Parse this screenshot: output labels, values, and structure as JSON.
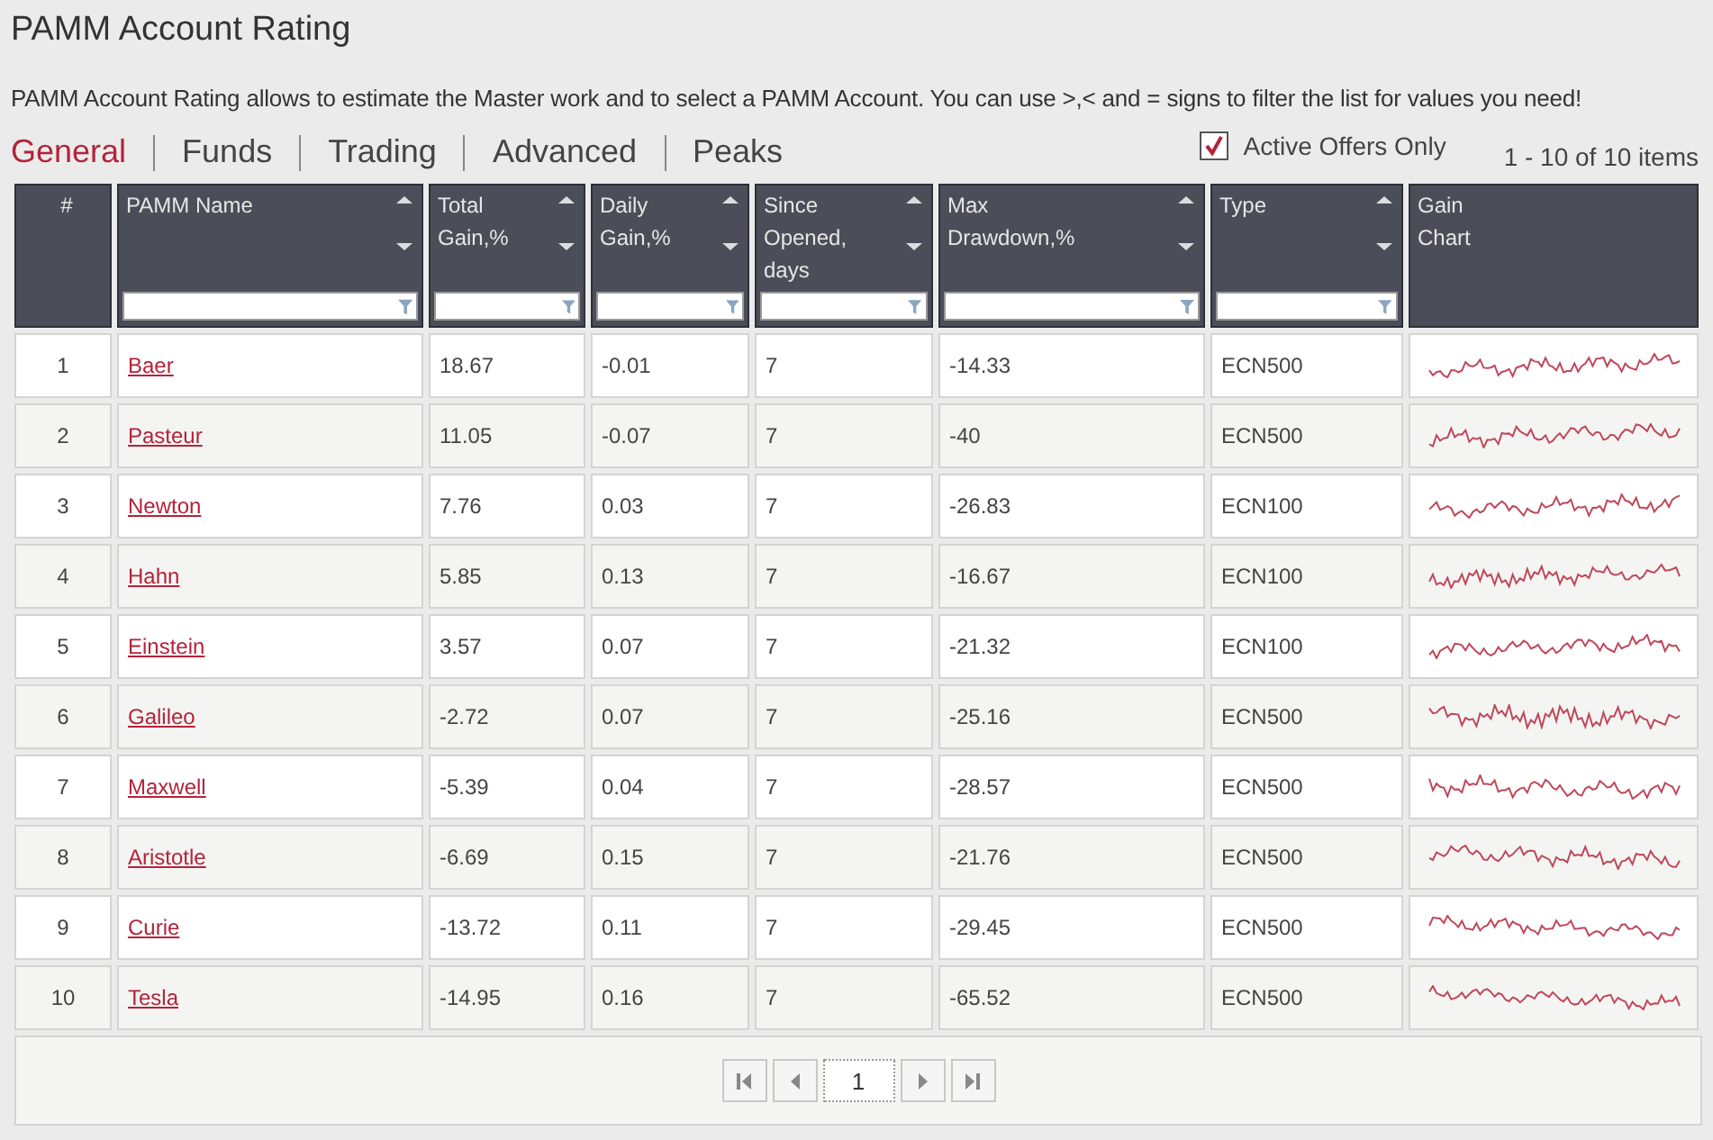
{
  "title": "PAMM Account Rating",
  "description": "PAMM Account Rating allows to estimate the Master work and to select a PAMM Account. You can use >,< and = signs to filter the list for values you need!",
  "tabs": [
    {
      "label": "General",
      "selected": true
    },
    {
      "label": "Funds",
      "selected": false
    },
    {
      "label": "Trading",
      "selected": false
    },
    {
      "label": "Advanced",
      "selected": false
    },
    {
      "label": "Peaks",
      "selected": false
    }
  ],
  "active_offers_only": {
    "label": "Active Offers Only",
    "checked": true
  },
  "item_count": "1 - 10 of 10 items",
  "columns": [
    {
      "label": "#",
      "kind": "plain"
    },
    {
      "label": "PAMM Name",
      "kind": "filter"
    },
    {
      "label": "Total Gain,%",
      "kind": "filter"
    },
    {
      "label": "Daily Gain,%",
      "kind": "filter"
    },
    {
      "label": "Since Opened, days",
      "kind": "filter"
    },
    {
      "label": "Max Drawdown,%",
      "kind": "filter"
    },
    {
      "label": "Type",
      "kind": "filter"
    },
    {
      "label": "Gain Chart",
      "kind": "plain"
    }
  ],
  "rows": [
    {
      "rank": "1",
      "name": "Baer",
      "total_gain": "18.67",
      "daily_gain": "-0.01",
      "days": "7",
      "max_drawdown": "-14.33",
      "type": "ECN500"
    },
    {
      "rank": "2",
      "name": "Pasteur",
      "total_gain": "11.05",
      "daily_gain": "-0.07",
      "days": "7",
      "max_drawdown": "-40",
      "type": "ECN500"
    },
    {
      "rank": "3",
      "name": "Newton",
      "total_gain": "7.76",
      "daily_gain": "0.03",
      "days": "7",
      "max_drawdown": "-26.83",
      "type": "ECN100"
    },
    {
      "rank": "4",
      "name": "Hahn",
      "total_gain": "5.85",
      "daily_gain": "0.13",
      "days": "7",
      "max_drawdown": "-16.67",
      "type": "ECN100"
    },
    {
      "rank": "5",
      "name": "Einstein",
      "total_gain": "3.57",
      "daily_gain": "0.07",
      "days": "7",
      "max_drawdown": "-21.32",
      "type": "ECN100"
    },
    {
      "rank": "6",
      "name": "Galileo",
      "total_gain": "-2.72",
      "daily_gain": "0.07",
      "days": "7",
      "max_drawdown": "-25.16",
      "type": "ECN500"
    },
    {
      "rank": "7",
      "name": "Maxwell",
      "total_gain": "-5.39",
      "daily_gain": "0.04",
      "days": "7",
      "max_drawdown": "-28.57",
      "type": "ECN500"
    },
    {
      "rank": "8",
      "name": "Aristotle",
      "total_gain": "-6.69",
      "daily_gain": "0.15",
      "days": "7",
      "max_drawdown": "-21.76",
      "type": "ECN500"
    },
    {
      "rank": "9",
      "name": "Curie",
      "total_gain": "-13.72",
      "daily_gain": "0.11",
      "days": "7",
      "max_drawdown": "-29.45",
      "type": "ECN500"
    },
    {
      "rank": "10",
      "name": "Tesla",
      "total_gain": "-14.95",
      "daily_gain": "0.16",
      "days": "7",
      "max_drawdown": "-65.52",
      "type": "ECN500"
    }
  ],
  "pager": {
    "page": "1"
  }
}
